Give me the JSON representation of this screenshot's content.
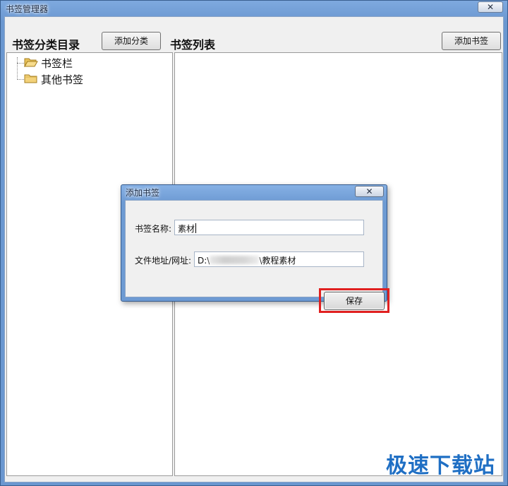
{
  "window": {
    "title": "书签管理器",
    "close_glyph": "✕"
  },
  "category_panel": {
    "heading": "书签分类目录",
    "add_button": "添加分类",
    "tree": [
      {
        "label": "书签栏",
        "icon": "folder-open-icon"
      },
      {
        "label": "其他书签",
        "icon": "folder-icon"
      }
    ]
  },
  "bookmark_panel": {
    "heading": "书签列表",
    "add_button": "添加书签"
  },
  "dialog": {
    "title": "添加书签",
    "close_glyph": "✕",
    "name_label": "书签名称:",
    "name_value": "素材",
    "url_label": "文件地址/网址:",
    "url_prefix": "D:\\",
    "url_suffix": "\\教程素材",
    "save_button": "保存"
  },
  "watermark": "极速下载站",
  "colors": {
    "title_bar": "#6f9bd1",
    "highlight": "#e02020",
    "folder": "#f3d27a",
    "watermark": "#1f6fc4"
  }
}
